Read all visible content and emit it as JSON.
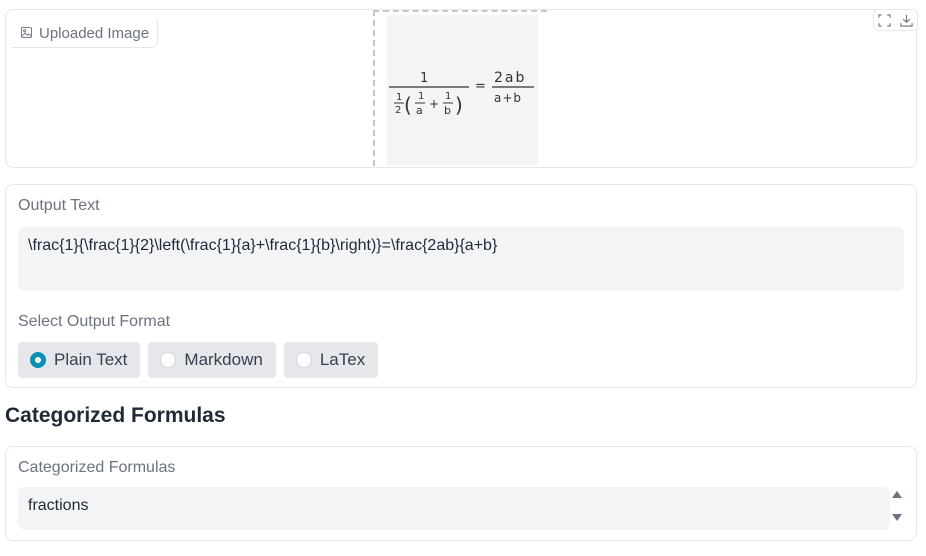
{
  "image_block": {
    "tag_label": "Uploaded Image",
    "tag_icon": "image-icon",
    "tools": [
      "fullscreen-icon",
      "download-icon"
    ],
    "formula_image": {
      "numerator": "1",
      "half_numer": "1",
      "half_denom": "2",
      "term1_numer": "1",
      "term1_denom": "a",
      "plus": "+",
      "term2_numer": "1",
      "term2_denom": "b",
      "equals": "=",
      "rhs_numer": "2ab",
      "rhs_denom": "a+b"
    }
  },
  "output": {
    "label": "Output Text",
    "value": "\\frac{1}{\\frac{1}{2}\\left(\\frac{1}{a}+\\frac{1}{b}\\right)}=\\frac{2ab}{a+b}",
    "format_label": "Select Output Format",
    "formats": [
      {
        "label": "Plain Text",
        "checked": true
      },
      {
        "label": "Markdown",
        "checked": false
      },
      {
        "label": "LaTex",
        "checked": false
      }
    ]
  },
  "categorized": {
    "section_title": "Categorized Formulas",
    "label": "Categorized Formulas",
    "value": "fractions"
  },
  "colors": {
    "accent": "#0891b2",
    "border": "#e5e7eb",
    "field_bg": "#f3f4f6"
  }
}
